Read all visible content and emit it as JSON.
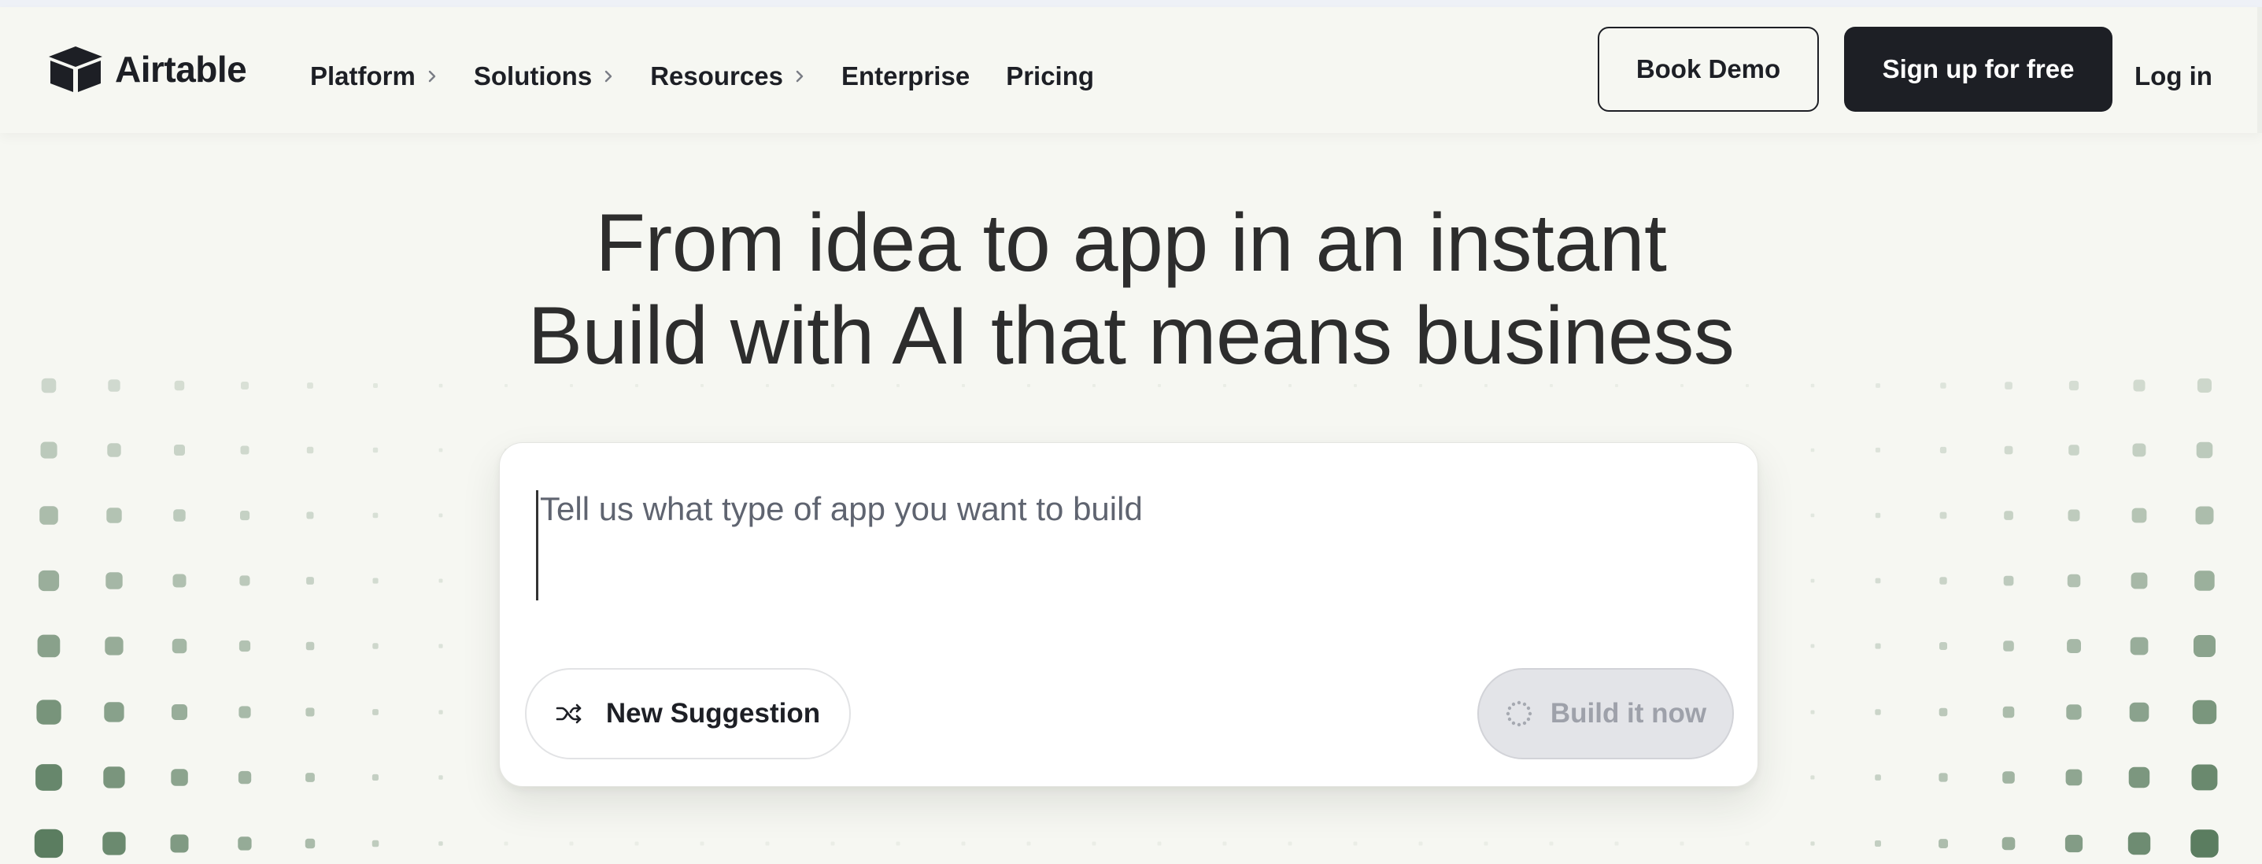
{
  "brand": {
    "name": "Airtable",
    "logo_icon": "airtable-box-icon"
  },
  "nav": {
    "items": [
      {
        "label": "Platform",
        "has_submenu": true
      },
      {
        "label": "Solutions",
        "has_submenu": true
      },
      {
        "label": "Resources",
        "has_submenu": true
      },
      {
        "label": "Enterprise",
        "has_submenu": false
      },
      {
        "label": "Pricing",
        "has_submenu": false
      }
    ],
    "book_demo_label": "Book Demo",
    "signup_label": "Sign up for free",
    "login_label": "Log in"
  },
  "hero": {
    "line1": "From idea to app in an instant",
    "line2": "Build with AI that means business"
  },
  "prompt": {
    "placeholder": "Tell us what type of app you want to build",
    "value": "",
    "suggest_label": "New Suggestion",
    "suggest_icon": "shuffle-icon",
    "build_label": "Build it now",
    "build_icon": "loading-spinner-icon",
    "build_enabled": false
  },
  "colors": {
    "background": "#f6f7f2",
    "text_primary": "#1d1f25",
    "heading": "#2d2d2d",
    "signup_bg": "#1d1f25",
    "dot_green": "#5b7d60",
    "build_disabled_bg": "#e3e4e8"
  }
}
